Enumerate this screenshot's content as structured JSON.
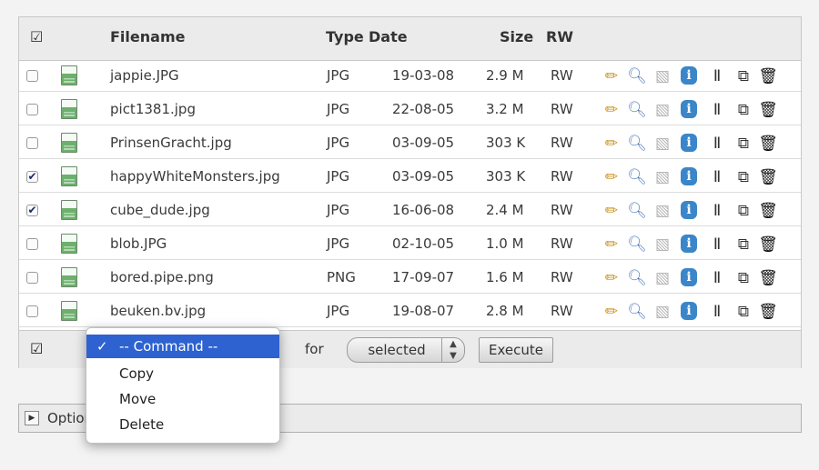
{
  "header": {
    "select_all_icon": "select-all-icon",
    "filename": "Filename",
    "type": "Type",
    "date": "Date",
    "size": "Size",
    "rw": "RW"
  },
  "files": [
    {
      "name": "jappie.JPG",
      "type": "JPG",
      "date": "19-03-08",
      "size": "2.9 M",
      "rw": "RW",
      "checked": false
    },
    {
      "name": "pict1381.jpg",
      "type": "JPG",
      "date": "22-08-05",
      "size": "3.2 M",
      "rw": "RW",
      "checked": false
    },
    {
      "name": "PrinsenGracht.jpg",
      "type": "JPG",
      "date": "03-09-05",
      "size": "303 K",
      "rw": "RW",
      "checked": false
    },
    {
      "name": "happyWhiteMonsters.jpg",
      "type": "JPG",
      "date": "03-09-05",
      "size": "303 K",
      "rw": "RW",
      "checked": true
    },
    {
      "name": "cube_dude.jpg",
      "type": "JPG",
      "date": "16-06-08",
      "size": "2.4 M",
      "rw": "RW",
      "checked": true
    },
    {
      "name": "blob.JPG",
      "type": "JPG",
      "date": "02-10-05",
      "size": "1.0 M",
      "rw": "RW",
      "checked": false
    },
    {
      "name": "bored.pipe.png",
      "type": "PNG",
      "date": "17-09-07",
      "size": "1.6 M",
      "rw": "RW",
      "checked": false
    },
    {
      "name": "beuken.bv.jpg",
      "type": "JPG",
      "date": "19-08-07",
      "size": "2.8 M",
      "rw": "RW",
      "checked": false
    }
  ],
  "row_actions": [
    "edit-pencil-icon",
    "view-magnifier-icon",
    "thumbnail-icon",
    "info-icon",
    "rename-icon",
    "copy-icon",
    "delete-trash-icon"
  ],
  "command_bar": {
    "for_label": "for",
    "target_value": "selected",
    "execute_label": "Execute"
  },
  "command_menu": {
    "selected": "-- Command --",
    "items": [
      "Copy",
      "Move",
      "Delete"
    ]
  },
  "options_bar": {
    "label": "Options"
  },
  "colors": {
    "menu_highlight": "#2d62d0",
    "info_icon": "#3a86c8",
    "header_bg": "#ebebeb"
  }
}
